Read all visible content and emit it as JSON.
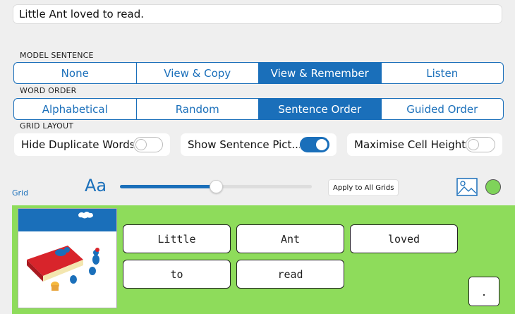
{
  "sentence": "Little Ant loved to read.",
  "model_sentence": {
    "label": "MODEL SENTENCE",
    "options": [
      "None",
      "View & Copy",
      "View & Remember",
      "Listen"
    ],
    "selected": 2
  },
  "word_order": {
    "label": "WORD ORDER",
    "options": [
      "Alphabetical",
      "Random",
      "Sentence Order",
      "Guided Order"
    ],
    "selected": 2
  },
  "grid_layout": {
    "label": "GRID LAYOUT",
    "toggles": [
      {
        "label": "Hide Duplicate Words",
        "on": false
      },
      {
        "label": "Show Sentence Pict...",
        "on": true
      },
      {
        "label": "Maximise Cell Height",
        "on": false
      }
    ]
  },
  "grid": {
    "label": "Grid",
    "font_icon": "Aa",
    "font_size_level": 0.5,
    "apply_label": "Apply to All Grids",
    "background_color": "#8edc5b",
    "color_swatch": "#7fd35a",
    "words": [
      "Little",
      "Ant",
      "loved",
      "to",
      "read"
    ],
    "punctuation": "."
  }
}
